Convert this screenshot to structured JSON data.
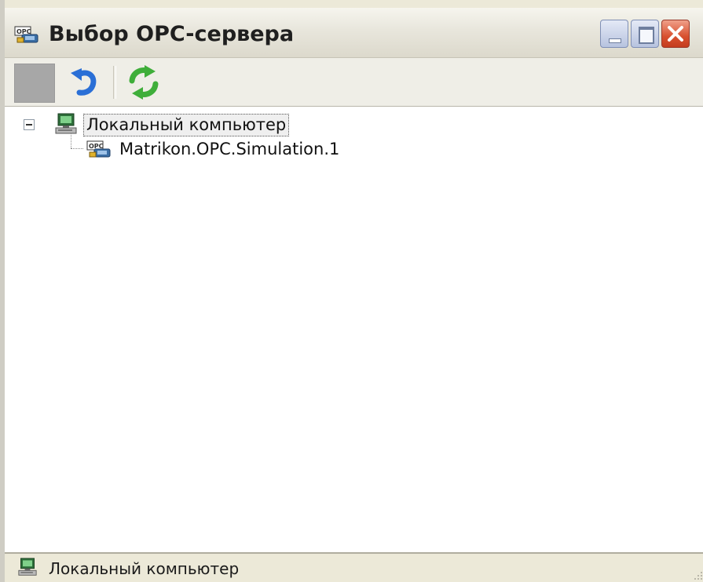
{
  "window": {
    "title": "Выбор OPC-сервера",
    "title_icon": "opc-server-icon"
  },
  "window_controls": {
    "minimize": "minimize-icon",
    "maximize": "maximize-icon",
    "close": "close-icon"
  },
  "toolbar": {
    "buttons": [
      {
        "icon": "disabled-button-icon",
        "enabled": false
      },
      {
        "icon": "undo-icon",
        "enabled": true
      },
      {
        "icon": "refresh-icon",
        "enabled": true
      }
    ]
  },
  "tree": {
    "root": {
      "label": "Локальный компьютер",
      "icon": "computer-icon",
      "expanded": true,
      "selected": true,
      "children": [
        {
          "label": "Matrikon.OPC.Simulation.1",
          "icon": "opc-server-icon"
        }
      ]
    }
  },
  "status": {
    "text": "Локальный компьютер",
    "icon": "computer-icon"
  },
  "colors": {
    "window_bg": "#ece9d8",
    "close_button": "#d8502f",
    "tree_bg": "#ffffff"
  }
}
